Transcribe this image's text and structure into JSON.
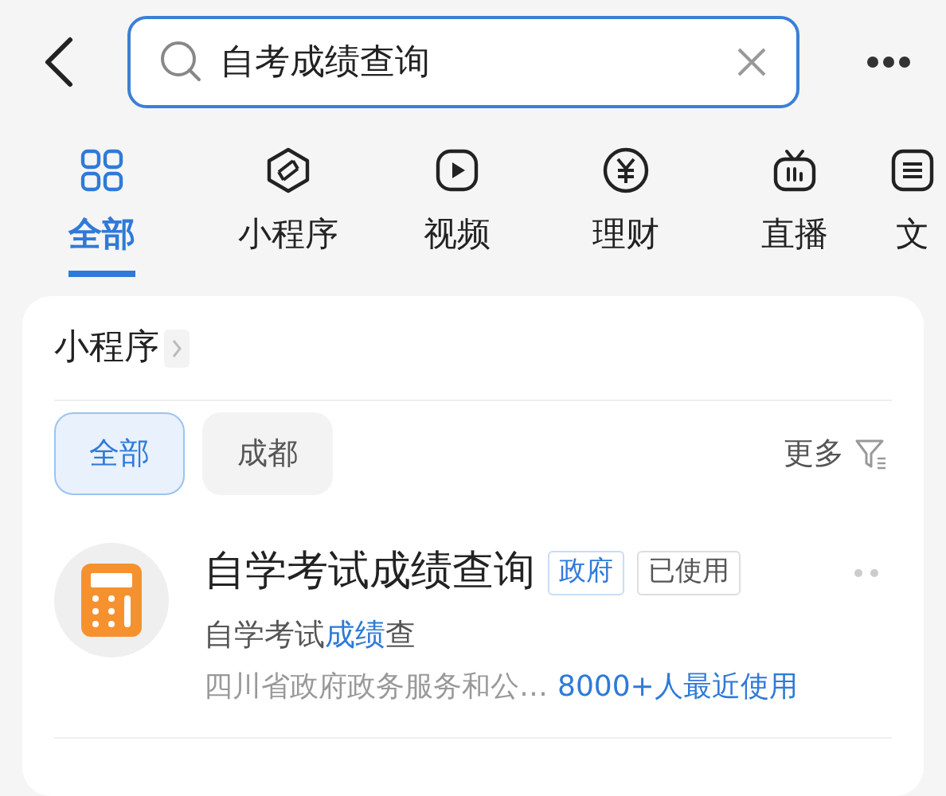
{
  "search": {
    "value": "自考成绩查询"
  },
  "tabs": [
    {
      "label": "全部",
      "kind": "grid",
      "selected": true
    },
    {
      "label": "小程序",
      "kind": "miniapp",
      "selected": false
    },
    {
      "label": "视频",
      "kind": "video",
      "selected": false
    },
    {
      "label": "理财",
      "kind": "finance",
      "selected": false
    },
    {
      "label": "直播",
      "kind": "live",
      "selected": false
    },
    {
      "label": "文",
      "kind": "article",
      "selected": false
    }
  ],
  "section": {
    "title": "小程序",
    "filters": [
      {
        "label": "全部",
        "selected": true
      },
      {
        "label": "成都",
        "selected": false
      }
    ],
    "more": "更多",
    "results": [
      {
        "title": "自学考试成绩查询",
        "tags": [
          {
            "label": "政府",
            "kind": "category"
          },
          {
            "label": "已使用",
            "kind": "status"
          }
        ],
        "description": [
          {
            "text": "自学考试",
            "highlight": false
          },
          {
            "text": "成绩",
            "highlight": true
          },
          {
            "text": "查",
            "highlight": false
          }
        ],
        "source": "四川省政府政务服务和公…",
        "usage": "8000+人最近使用"
      }
    ]
  }
}
